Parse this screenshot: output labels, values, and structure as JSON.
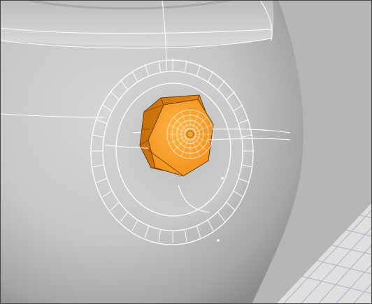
{
  "viewport": {
    "kind": "3D modeling perspective viewport",
    "label": "",
    "background_color": "#b5b6b8",
    "floor_color": "#dedfe1",
    "grid_color": "#aeb2b7",
    "border_color": "#454545"
  },
  "scene": {
    "objects": [
      {
        "name": "pot-body",
        "color": "#c9c9c9",
        "edge_color": "#ffffff",
        "selected": false
      },
      {
        "name": "boss-ring",
        "edge_color": "#ffffff",
        "selected": false
      },
      {
        "name": "hex-nut",
        "color": "#f49a21",
        "edge_color": "#6b3c06",
        "selected": true
      }
    ],
    "selection_color": "#f49a21",
    "wireframe_color": "#ffffff"
  }
}
